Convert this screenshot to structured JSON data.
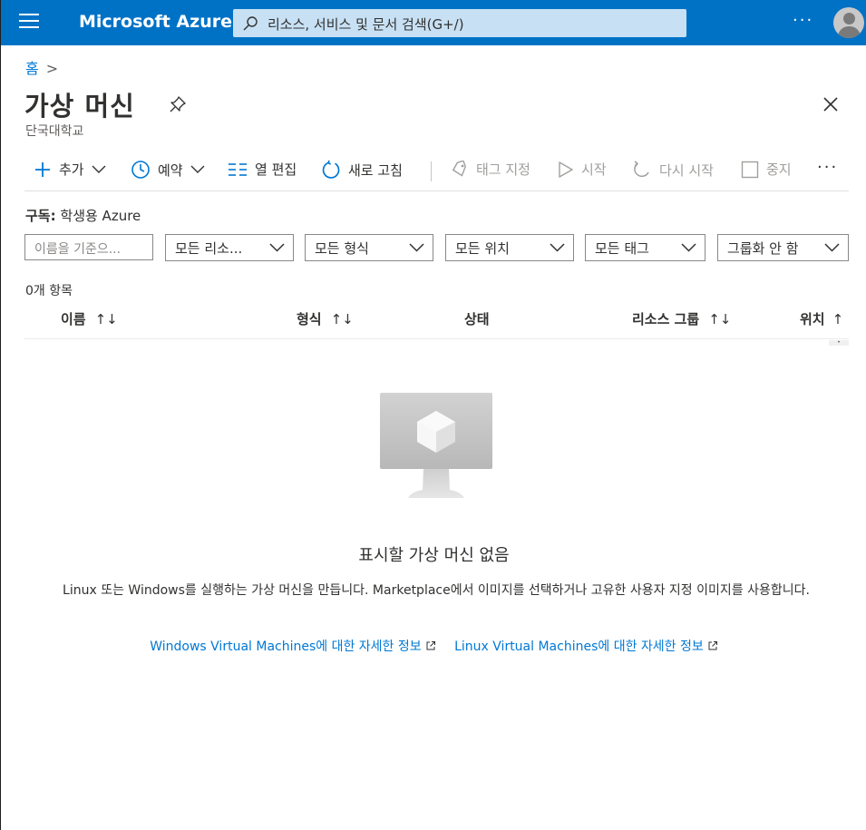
{
  "topbar": {
    "brand": "Microsoft Azure",
    "search_placeholder": "리소스, 서비스 및 문서 검색(G+/)",
    "more": "···"
  },
  "breadcrumb": {
    "home": "홈",
    "separator": ">"
  },
  "page": {
    "title": "가상 머신",
    "subtitle": "단국대학교"
  },
  "commands": {
    "add": "추가",
    "schedule": "예약",
    "edit_columns": "열 편집",
    "refresh": "새로 고침",
    "assign_tags": "태그 지정",
    "start": "시작",
    "restart": "다시 시작",
    "stop": "중지",
    "more": "···"
  },
  "subscription": {
    "label": "구독:",
    "value": "학생용 Azure"
  },
  "filters": {
    "name_placeholder": "이름을 기준으...",
    "resource_groups": "모든 리소...",
    "types": "모든 형식",
    "locations": "모든 위치",
    "tags": "모든 태그",
    "grouping": "그룹화 안 함"
  },
  "list": {
    "count": "0개 항목",
    "columns": [
      {
        "label": "이름",
        "sort": "↑↓"
      },
      {
        "label": "형식",
        "sort": "↑↓"
      },
      {
        "label": "상태",
        "sort": ""
      },
      {
        "label": "리소스 그룹",
        "sort": "↑↓"
      },
      {
        "label": "위치",
        "sort": "↑"
      }
    ],
    "scroll_glyph": "•"
  },
  "empty_state": {
    "title": "표시할 가상 머신 없음",
    "description": "Linux 또는 Windows를 실행하는 가상 머신을 만듭니다. Marketplace에서 이미지를 선택하거나 고유한 사용자 지정 이미지를 사용합니다.",
    "link_windows": "Windows Virtual Machines에 대한 자세한 정보",
    "link_linux": "Linux Virtual Machines에 대한 자세한 정보"
  },
  "colors": {
    "header": "#0072c6",
    "accent": "#0078d4",
    "search_bg": "#c7e0f4"
  }
}
